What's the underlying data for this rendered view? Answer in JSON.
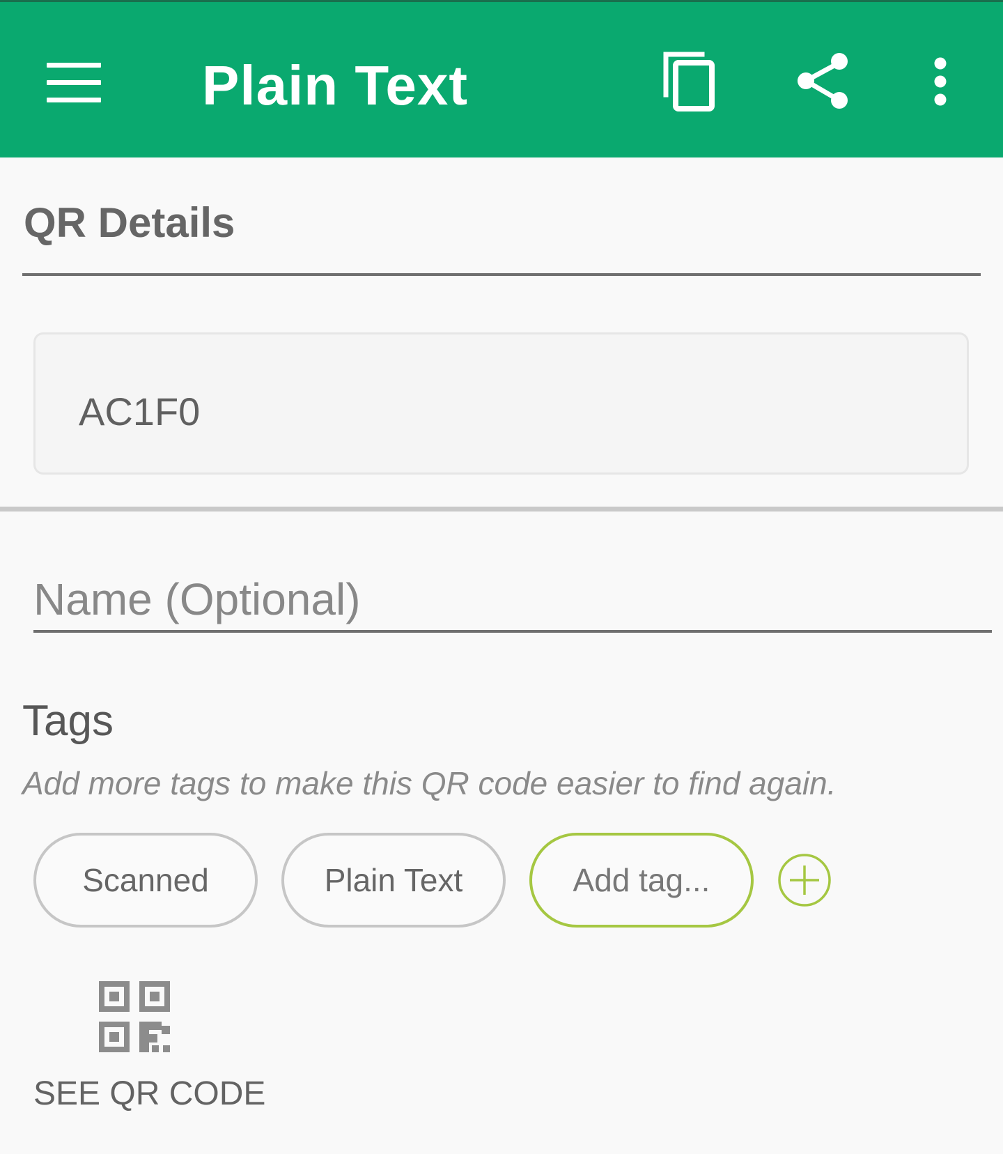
{
  "appbar": {
    "title": "Plain Text",
    "background": "#0aa96f",
    "icons": [
      "menu-icon",
      "copy-icon",
      "share-icon",
      "more-vertical-icon"
    ]
  },
  "qr_details": {
    "title": "QR Details",
    "content": "AC1F0"
  },
  "name_field": {
    "placeholder": "Name (Optional)",
    "value": ""
  },
  "tags": {
    "title": "Tags",
    "hint": "Add more tags to make this QR code easier to find again.",
    "chips": [
      {
        "label": "Scanned"
      },
      {
        "label": "Plain Text"
      }
    ],
    "add_label": "Add tag...",
    "accent": "#a5c742"
  },
  "see_qr": {
    "label": "SEE QR CODE",
    "icon": "qr-code-icon"
  }
}
